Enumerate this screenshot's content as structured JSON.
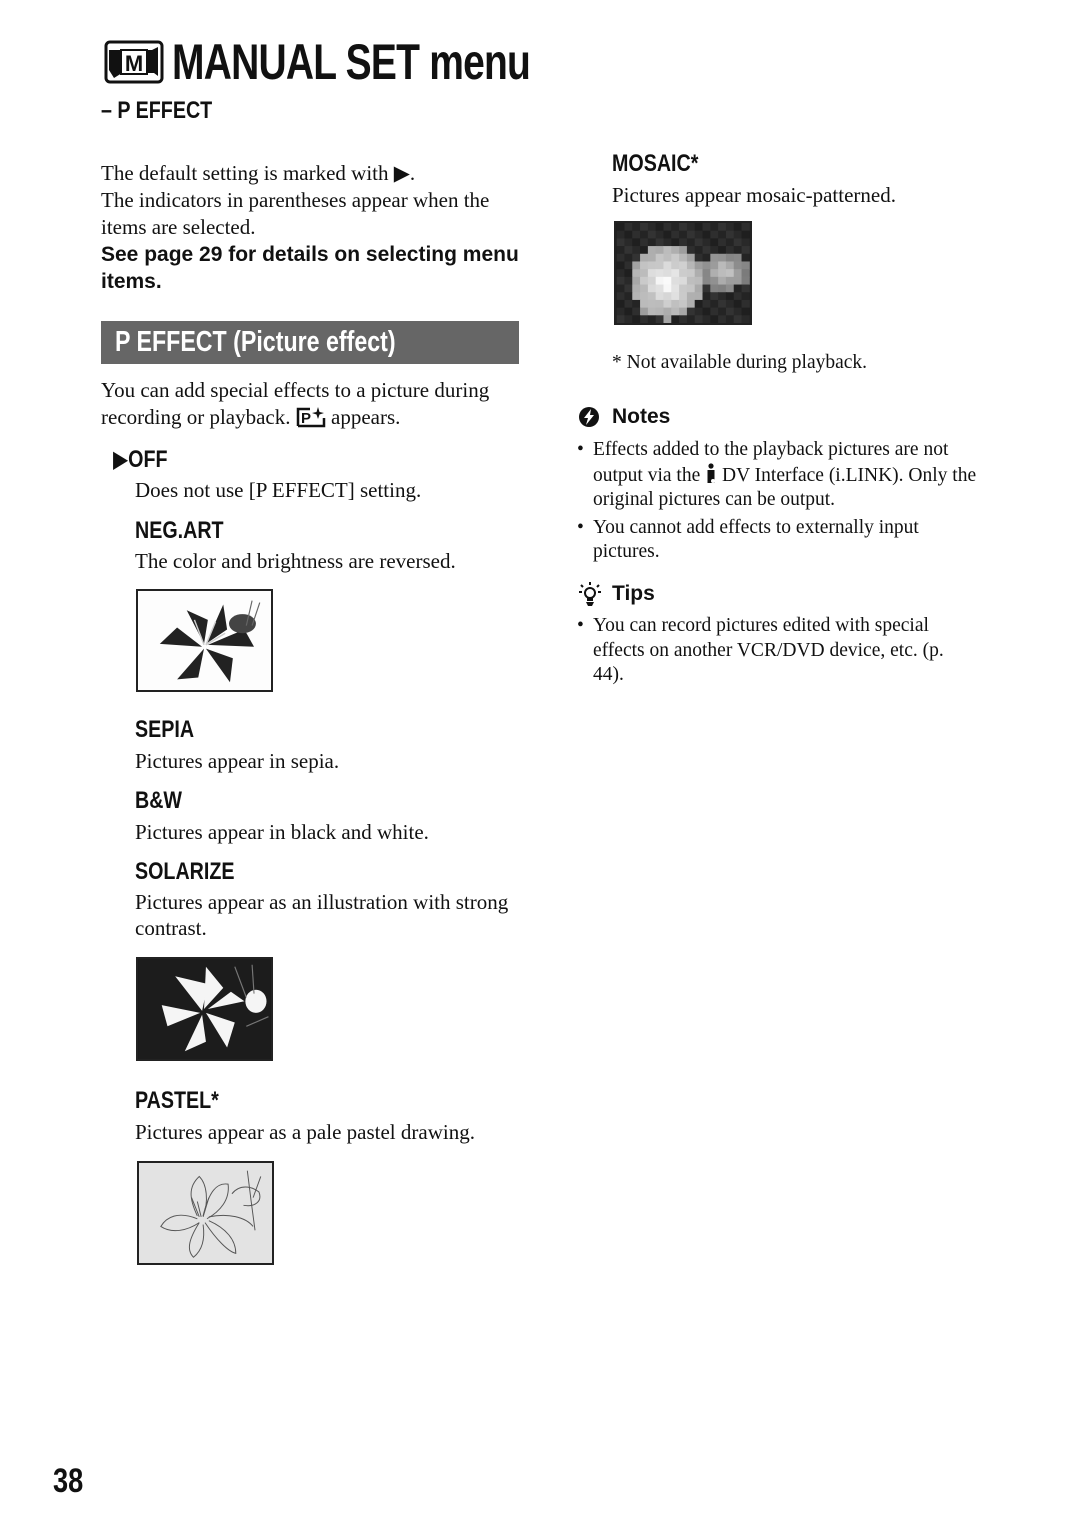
{
  "header": {
    "title": "MANUAL SET menu",
    "subtitle": "– P EFFECT",
    "icon": "manual-set-camera-icon"
  },
  "intro": {
    "line1": "The default setting is marked with ▶.",
    "line2": "The indicators in parentheses appear when the items are selected.",
    "see_page": "See page 29 for details on selecting menu items."
  },
  "section": {
    "title": "P EFFECT (Picture effect)",
    "desc_before_icon": "You can add special effects to a picture during recording or playback.",
    "desc_after_icon": "appears.",
    "indicator_icon": "picture-effect-indicator-icon"
  },
  "options": [
    {
      "marker": "▶",
      "title": "OFF",
      "desc": "Does not use [P EFFECT] setting.",
      "default": true
    },
    {
      "title": "NEG.ART",
      "desc": "The color and brightness are reversed.",
      "image": "negative-lily-sample"
    },
    {
      "title": "SEPIA",
      "desc": "Pictures appear in sepia."
    },
    {
      "title": "B&W",
      "desc": "Pictures appear in black and white."
    },
    {
      "title": "SOLARIZE",
      "desc": "Pictures appear as an illustration with strong contrast.",
      "image": "solarized-lily-sample"
    },
    {
      "title": "PASTEL*",
      "desc": "Pictures appear as a pale pastel drawing.",
      "image": "pastel-lily-sample"
    },
    {
      "title": "MOSAIC*",
      "desc": "Pictures appear mosaic-patterned.",
      "image": "mosaic-lily-sample"
    }
  ],
  "footnote": "*  Not available during playback.",
  "notes": {
    "heading": "Notes",
    "icon": "notes-icon",
    "items": [
      {
        "before_icon": "Effects added to the playback pictures are not output via the",
        "after_icon": "DV Interface (i.LINK). Only the original pictures can be output."
      },
      {
        "text": "You cannot add effects to externally input pictures."
      }
    ]
  },
  "tips": {
    "heading": "Tips",
    "icon": "lightbulb-icon",
    "items": [
      {
        "text": "You can record pictures edited with special effects on another VCR/DVD device, etc. (p. 44)."
      }
    ]
  },
  "page_number": "38",
  "colors": {
    "section_bar": "#666666",
    "text": "#111111"
  }
}
